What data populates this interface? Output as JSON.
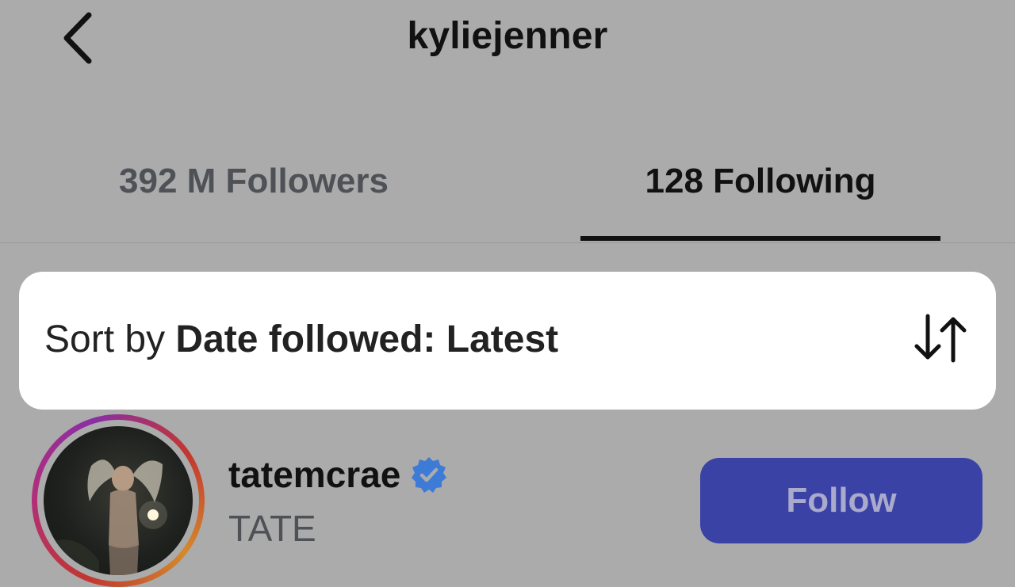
{
  "header": {
    "title": "kyliejenner",
    "back_icon": "chevron-left-icon"
  },
  "tabs": [
    {
      "label": "392 M Followers",
      "active": false
    },
    {
      "label": "128 Following",
      "active": true
    }
  ],
  "sort": {
    "prefix": "Sort by ",
    "value": "Date followed: Latest",
    "icon": "sort-arrows-icon"
  },
  "users": [
    {
      "username": "tatemcrae",
      "verified": true,
      "full_name": "TATE",
      "follow_label": "Follow"
    }
  ],
  "colors": {
    "overlay_bg": "#ababab",
    "follow_button": "#3a42a6",
    "verified_badge": "#3d7bd6",
    "story_ring": "#b22e7a"
  }
}
